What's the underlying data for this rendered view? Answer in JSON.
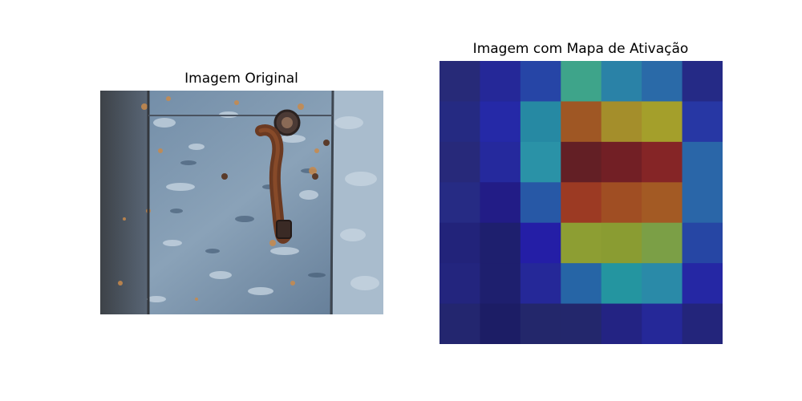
{
  "left_panel": {
    "title": "Imagem Original"
  },
  "right_panel": {
    "title": "Imagem com Mapa de Ativação",
    "grid": {
      "rows": 7,
      "cols": 7,
      "colors": [
        [
          "#272a78",
          "#252898",
          "#2645a6",
          "#3ea48a",
          "#2a82a7",
          "#2a6aa8",
          "#252a86"
        ],
        [
          "#252a82",
          "#2529a7",
          "#2689a3",
          "#9f5724",
          "#a48e2b",
          "#a49f2b",
          "#2737a4"
        ],
        [
          "#27297a",
          "#25299d",
          "#2a92a7",
          "#631f25",
          "#721f25",
          "#852526",
          "#2a66a8"
        ],
        [
          "#262b84",
          "#221c86",
          "#2758a6",
          "#9c3a23",
          "#a04e23",
          "#a35a24",
          "#2a66a8"
        ],
        [
          "#22237a",
          "#1e1f6e",
          "#241ea6",
          "#8d9e33",
          "#8a9c32",
          "#7b9f46",
          "#2646a4"
        ],
        [
          "#23257e",
          "#1e1f6e",
          "#252898",
          "#2665a6",
          "#2495a0",
          "#2a8aa8",
          "#2527a4"
        ],
        [
          "#23266f",
          "#1c1d65",
          "#23276b",
          "#23276c",
          "#232383",
          "#252898",
          "#23257b"
        ]
      ]
    }
  },
  "icons": {
    "photo": "rusty-door-handle-photo"
  }
}
